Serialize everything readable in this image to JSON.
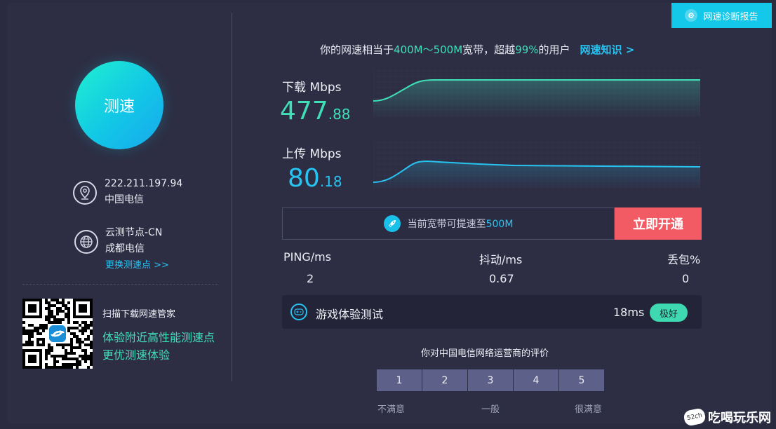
{
  "report_button": {
    "label": "网速诊断报告"
  },
  "speed_button": {
    "label": "测速"
  },
  "summary": {
    "prefix": "你的网速相当于",
    "range": "400M～500M",
    "middle": "宽带，超越",
    "percent": "99%",
    "suffix": "的用户",
    "knowledge_link": "网速知识 >"
  },
  "client": {
    "ip": "222.211.197.94",
    "isp": "中国电信"
  },
  "node": {
    "name": "云测节点-CN",
    "isp": "成都电信",
    "change_link": "更换测速点 >>"
  },
  "qr": {
    "caption": "扫描下载网速管家",
    "line1": "体验附近高性能测速点",
    "line2": "更优测速体验"
  },
  "download": {
    "label": "下载 Mbps",
    "int": "477",
    "dec": ".88"
  },
  "upload": {
    "label": "上传 Mbps",
    "int": "80",
    "dec": ".18"
  },
  "promo": {
    "text": "当前宽带可提速至",
    "value": "500M",
    "button": "立即开通"
  },
  "stats": {
    "ping_label": "PING/ms",
    "ping_value": "2",
    "jitter_label": "抖动/ms",
    "jitter_value": "0.67",
    "loss_label": "丢包%",
    "loss_value": "0"
  },
  "game": {
    "title": "游戏体验测试",
    "latency": "18ms",
    "badge": "极好"
  },
  "rating": {
    "title": "你对中国电信网络运营商的评价",
    "options": [
      "1",
      "2",
      "3",
      "4",
      "5"
    ],
    "low": "不满意",
    "mid": "一般",
    "high": "很满意"
  },
  "watermark": {
    "logo": "52ch",
    "text": "吃喝玩乐网"
  },
  "colors": {
    "accent_green": "#3fe0b8",
    "accent_blue": "#27c4f2",
    "cta_red": "#f25a64",
    "background": "#2d2e44"
  },
  "icons": [
    "location-pin-icon",
    "globe-icon",
    "rocket-icon",
    "gamepad-icon",
    "diagnostic-icon"
  ]
}
